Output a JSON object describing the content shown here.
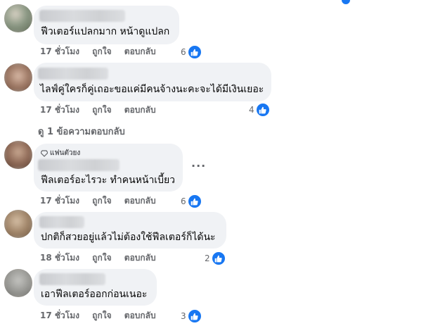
{
  "colors": {
    "accent": "#1877f2",
    "bubble": "#f0f2f5",
    "meta": "#65676b",
    "text": "#050505"
  },
  "actions": {
    "time": "17 ชั่วโมง",
    "like": "ถูกใจ",
    "reply": "ตอบกลับ"
  },
  "comments": [
    {
      "text": "ฟีวเตอร์แปลกมาก หน้าดูแปลก",
      "time": "17 ชั่วโมง",
      "reactions": "6"
    },
    {
      "text": "ไลฟ์คู่ใครก็คู่เถอะขอแค่มีคนจ้างนะคะจะได้มีเงินเยอะ",
      "time": "17 ชั่วโมง",
      "reactions": "4"
    },
    {
      "badge": "แฟนตัวยง",
      "text": "ฟีลเตอร์อะไรวะ ทำคนหน้าเบี้ยว",
      "time": "17 ชั่วโมง",
      "reactions": "6"
    },
    {
      "text": "ปกติก็สวยอยู่แล้วไม่ต้องใช้ฟีลเตอร์ก็ได้นะ",
      "time": "18 ชั่วโมง",
      "reactions": "2"
    },
    {
      "text": "เอาฟีลเตอร์ออกก่อนเนอะ",
      "time": "17 ชั่วโมง",
      "reactions": "3"
    }
  ],
  "view_replies": "ดู 1 ข้อความตอบกลับ",
  "icons": {
    "like": "thumbs-up-icon",
    "badge": "diamond-icon",
    "more": "more-options-icon"
  }
}
